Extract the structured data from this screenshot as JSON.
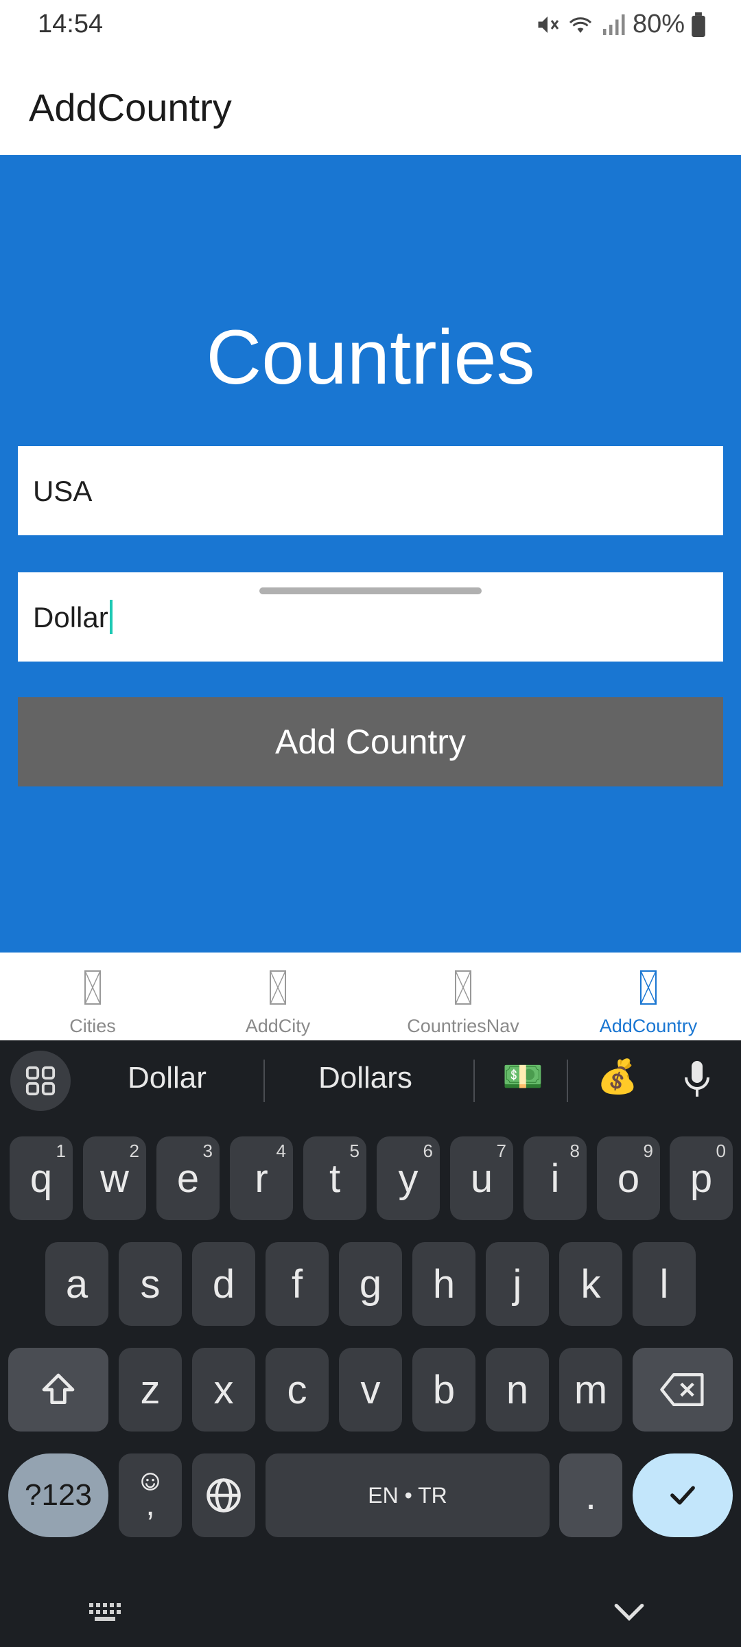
{
  "status_bar": {
    "time": "14:54",
    "battery": "80%",
    "icons": [
      "mute-icon",
      "wifi-icon",
      "signal-icon",
      "battery-icon"
    ]
  },
  "app_bar": {
    "title": "AddCountry"
  },
  "main": {
    "background": "#1976d2",
    "heading": "Countries",
    "country_field": {
      "value": "USA"
    },
    "currency_field": {
      "value": "Dollar"
    },
    "add_button": "Add Country"
  },
  "tabs": [
    {
      "label": "Cities",
      "active": false
    },
    {
      "label": "AddCity",
      "active": false
    },
    {
      "label": "CountriesNav",
      "active": false
    },
    {
      "label": "AddCountry",
      "active": true
    }
  ],
  "keyboard": {
    "suggestions": [
      "Dollar",
      "Dollars"
    ],
    "emoji_suggestions": [
      "💵",
      "💰"
    ],
    "row1": [
      {
        "key": "q",
        "hint": "1"
      },
      {
        "key": "w",
        "hint": "2"
      },
      {
        "key": "e",
        "hint": "3"
      },
      {
        "key": "r",
        "hint": "4"
      },
      {
        "key": "t",
        "hint": "5"
      },
      {
        "key": "y",
        "hint": "6"
      },
      {
        "key": "u",
        "hint": "7"
      },
      {
        "key": "i",
        "hint": "8"
      },
      {
        "key": "o",
        "hint": "9"
      },
      {
        "key": "p",
        "hint": "0"
      }
    ],
    "row2": [
      "a",
      "s",
      "d",
      "f",
      "g",
      "h",
      "j",
      "k",
      "l"
    ],
    "row3": [
      "z",
      "x",
      "c",
      "v",
      "b",
      "n",
      "m"
    ],
    "symbols_key": "?123",
    "comma_key": ",",
    "space_label": "EN • TR",
    "period_key": "."
  }
}
